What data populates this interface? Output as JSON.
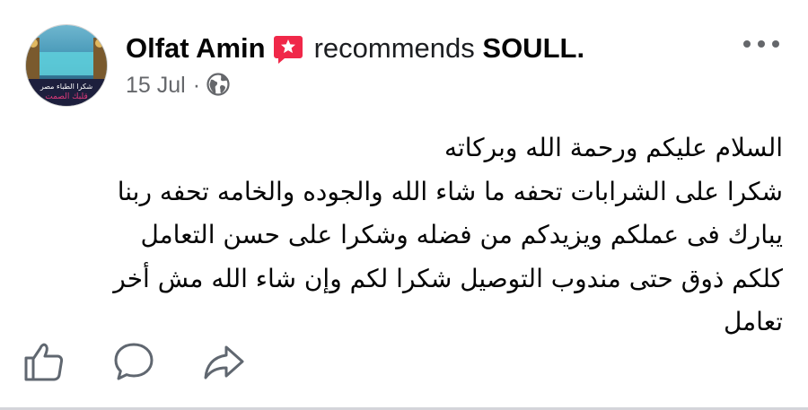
{
  "post": {
    "author": {
      "name": "Olfat Amin",
      "avatar_text_line1": "شكرا الطباء مصر",
      "avatar_text_line2": "قلبك الصمت",
      "avatar_colors": [
        "#1f2a4a",
        "#4fb3c7",
        "#c9a45a"
      ],
      "badge_icon": "recommendation-star-icon",
      "badge_color": "#f02849"
    },
    "action_text": "recommends",
    "page_name": "SOULL.",
    "date": "15 Jul",
    "separator": "·",
    "privacy_icon": "globe-icon",
    "text_lines": [
      "السلام عليكم ورحمة الله وبركاته",
      "شكرا على الشرابات تحفه ما شاء الله والجوده والخامه تحفه ربنا",
      "يبارك فى عملكم ويزيدكم من فضله وشكرا على حسن التعامل",
      "كلكم ذوق حتى مندوب التوصيل شكرا لكم وإن شاء الله مش أخر",
      "تعامل"
    ],
    "actions": [
      "like-icon",
      "comment-icon",
      "share-icon"
    ],
    "icon_color": "#606770"
  }
}
